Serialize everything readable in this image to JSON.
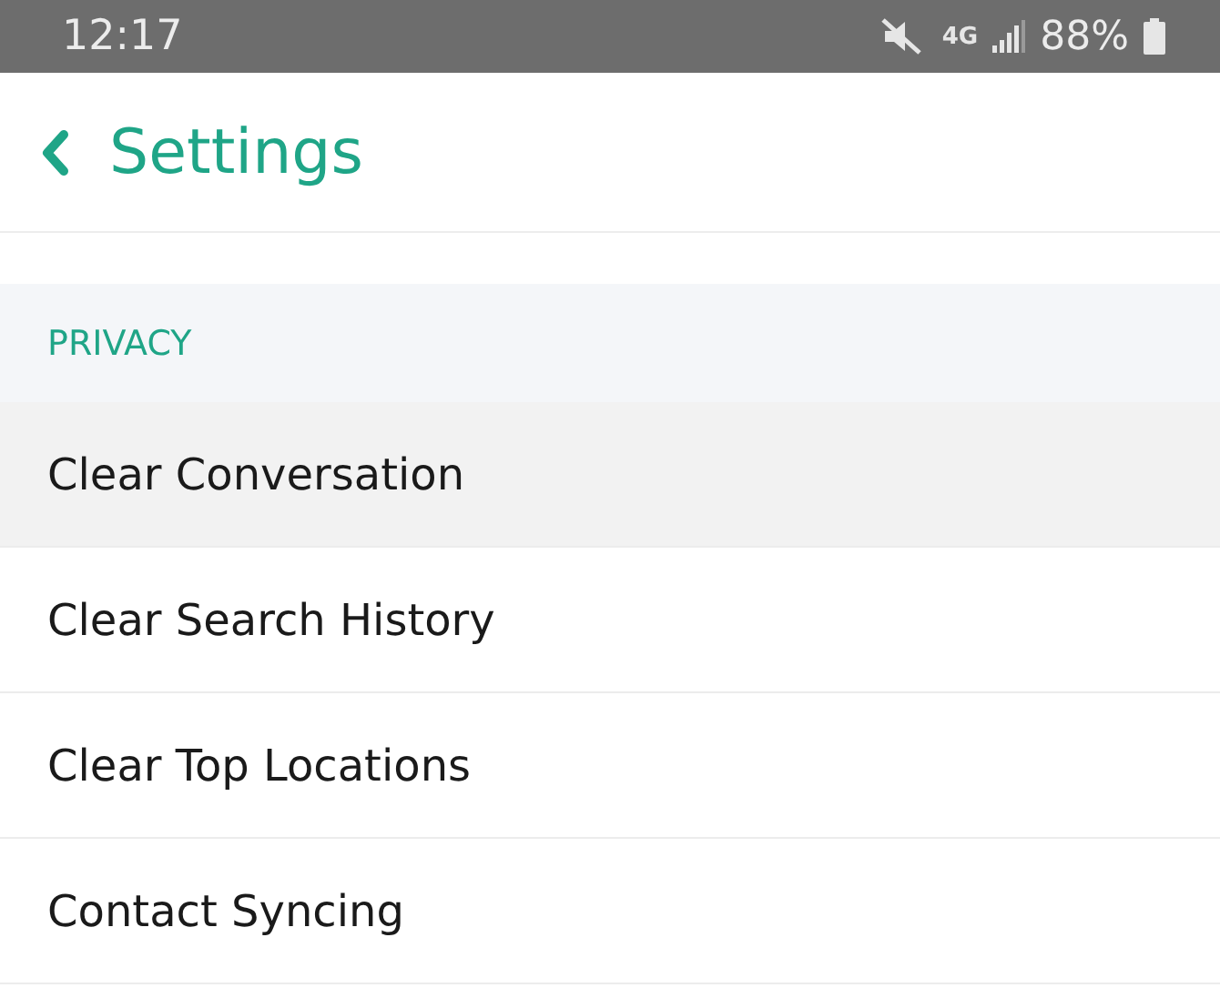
{
  "status_bar": {
    "time": "12:17",
    "network": "4G",
    "battery": "88%"
  },
  "header": {
    "title": "Settings"
  },
  "section": {
    "title": "PRIVACY"
  },
  "items": [
    {
      "label": "Clear Conversation",
      "selected": true
    },
    {
      "label": "Clear Search History",
      "selected": false
    },
    {
      "label": "Clear Top Locations",
      "selected": false
    },
    {
      "label": "Contact Syncing",
      "selected": false
    }
  ]
}
